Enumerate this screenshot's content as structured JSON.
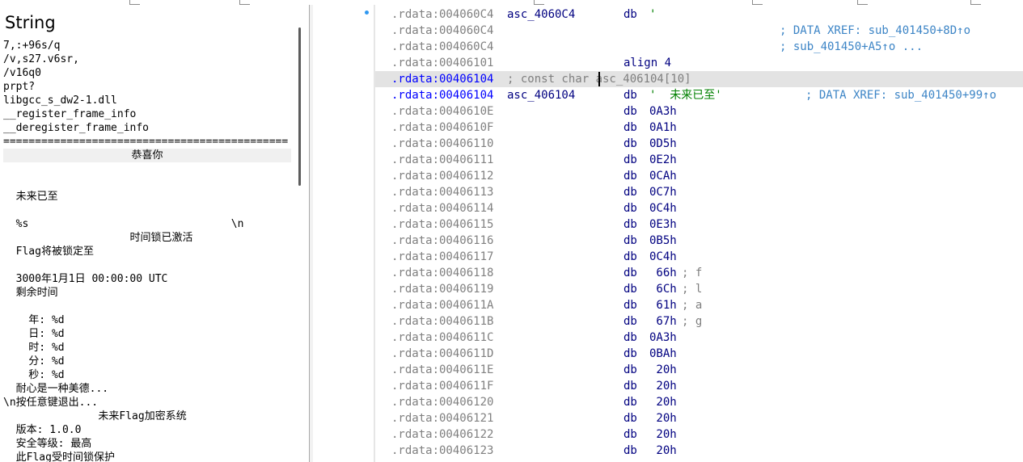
{
  "strings_panel": {
    "title": "String",
    "items": [
      "7,:+96s/q",
      "/v,s27.v6sr,",
      "/v16q0",
      "prpt?",
      "libgcc_s_dw2-1.dll",
      "__register_frame_info",
      "__deregister_frame_info",
      "=============================================",
      "恭喜你",
      "",
      "",
      "  未来已至",
      "",
      "  %s                                \\n",
      "                    时间锁已激活",
      "  Flag将被锁定至",
      "",
      "  3000年1月1日 00:00:00 UTC",
      "  剩余时间",
      "",
      "    年: %d",
      "    日: %d",
      "    时: %d",
      "    分: %d",
      "    秒: %d",
      "  耐心是一种美德...",
      "\\n按任意键退出...",
      "               未来Flag加密系统",
      "  版本: 1.0.0",
      "  安全等级: 最高",
      "  此Flag受时间锁保护"
    ]
  },
  "disassembly": {
    "lines": [
      {
        "addr": ".rdata:004060C4",
        "label": "asc_4060C4",
        "mnem": "db",
        "oper": "'",
        "comment": "",
        "xref": "",
        "dot": true
      },
      {
        "addr": ".rdata:004060C4",
        "label": "",
        "mnem": "",
        "oper": "",
        "comment": "",
        "xref": "; DATA XREF: sub_401450+8D↑o",
        "xref_col": 500,
        "dot": false
      },
      {
        "addr": ".rdata:004060C4",
        "label": "",
        "mnem": "",
        "oper": "",
        "comment": "",
        "xref": "; sub_401450+A5↑o ...",
        "xref_col": 500,
        "dot": false
      },
      {
        "addr": ".rdata:00406101",
        "label": "",
        "mnem": "align 4",
        "oper": "",
        "comment": "",
        "xref": "",
        "dot": false
      },
      {
        "addr": ".rdata:00406104",
        "label": "",
        "mnem": "",
        "oper": "",
        "comment": "; const char asc_406104[10]",
        "xref": "",
        "highlight": true,
        "cur": true,
        "dot": false
      },
      {
        "addr": ".rdata:00406104",
        "label": "asc_406104",
        "mnem": "db",
        "oper": "'  未来已至'",
        "comment": "",
        "xref": "; DATA XREF: sub_401450+99↑o",
        "xref_col": 532,
        "cur": true,
        "dot": false
      },
      {
        "addr": ".rdata:0040610E",
        "label": "",
        "mnem": "db",
        "oper": "0A3h",
        "comment": "",
        "xref": "",
        "dot": false
      },
      {
        "addr": ".rdata:0040610F",
        "label": "",
        "mnem": "db",
        "oper": "0A1h",
        "comment": "",
        "xref": "",
        "dot": false
      },
      {
        "addr": ".rdata:00406110",
        "label": "",
        "mnem": "db",
        "oper": "0D5h",
        "comment": "",
        "xref": "",
        "dot": false
      },
      {
        "addr": ".rdata:00406111",
        "label": "",
        "mnem": "db",
        "oper": "0E2h",
        "comment": "",
        "xref": "",
        "dot": false
      },
      {
        "addr": ".rdata:00406112",
        "label": "",
        "mnem": "db",
        "oper": "0CAh",
        "comment": "",
        "xref": "",
        "dot": false
      },
      {
        "addr": ".rdata:00406113",
        "label": "",
        "mnem": "db",
        "oper": "0C7h",
        "comment": "",
        "xref": "",
        "dot": false
      },
      {
        "addr": ".rdata:00406114",
        "label": "",
        "mnem": "db",
        "oper": "0C4h",
        "comment": "",
        "xref": "",
        "dot": false
      },
      {
        "addr": ".rdata:00406115",
        "label": "",
        "mnem": "db",
        "oper": "0E3h",
        "comment": "",
        "xref": "",
        "dot": false
      },
      {
        "addr": ".rdata:00406116",
        "label": "",
        "mnem": "db",
        "oper": "0B5h",
        "comment": "",
        "xref": "",
        "dot": false
      },
      {
        "addr": ".rdata:00406117",
        "label": "",
        "mnem": "db",
        "oper": "0C4h",
        "comment": "",
        "xref": "",
        "dot": false
      },
      {
        "addr": ".rdata:00406118",
        "label": "",
        "mnem": "db",
        "oper": " 66h",
        "comment": "; f",
        "xref": "",
        "dot": false
      },
      {
        "addr": ".rdata:00406119",
        "label": "",
        "mnem": "db",
        "oper": " 6Ch",
        "comment": "; l",
        "xref": "",
        "dot": false
      },
      {
        "addr": ".rdata:0040611A",
        "label": "",
        "mnem": "db",
        "oper": " 61h",
        "comment": "; a",
        "xref": "",
        "dot": false
      },
      {
        "addr": ".rdata:0040611B",
        "label": "",
        "mnem": "db",
        "oper": " 67h",
        "comment": "; g",
        "xref": "",
        "dot": false
      },
      {
        "addr": ".rdata:0040611C",
        "label": "",
        "mnem": "db",
        "oper": "0A3h",
        "comment": "",
        "xref": "",
        "dot": false
      },
      {
        "addr": ".rdata:0040611D",
        "label": "",
        "mnem": "db",
        "oper": "0BAh",
        "comment": "",
        "xref": "",
        "dot": false
      },
      {
        "addr": ".rdata:0040611E",
        "label": "",
        "mnem": "db",
        "oper": " 20h",
        "comment": "",
        "xref": "",
        "dot": false
      },
      {
        "addr": ".rdata:0040611F",
        "label": "",
        "mnem": "db",
        "oper": " 20h",
        "comment": "",
        "xref": "",
        "dot": false
      },
      {
        "addr": ".rdata:00406120",
        "label": "",
        "mnem": "db",
        "oper": " 20h",
        "comment": "",
        "xref": "",
        "dot": false
      },
      {
        "addr": ".rdata:00406121",
        "label": "",
        "mnem": "db",
        "oper": " 20h",
        "comment": "",
        "xref": "",
        "dot": false
      },
      {
        "addr": ".rdata:00406122",
        "label": "",
        "mnem": "db",
        "oper": " 20h",
        "comment": "",
        "xref": "",
        "dot": false
      },
      {
        "addr": ".rdata:00406123",
        "label": "",
        "mnem": "db",
        "oper": " 20h",
        "comment": "",
        "xref": "",
        "dot": false
      }
    ]
  },
  "colors": {
    "address": "#808080",
    "current_address": "#0000ff",
    "label": "#000080",
    "operand_string": "#008000",
    "comment": "#7f7f7f",
    "xref": "#3d85c6",
    "highlight_row": "#e3e3e3",
    "gutter_dot": "#2f97f0"
  }
}
